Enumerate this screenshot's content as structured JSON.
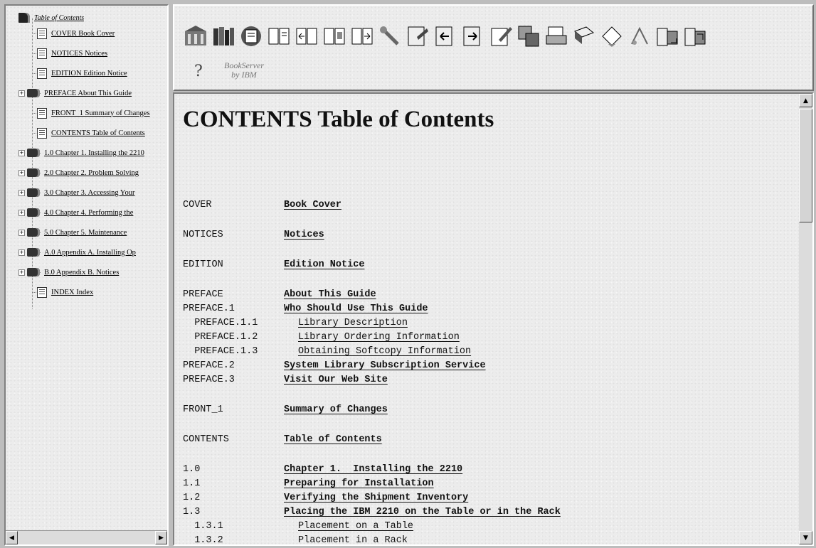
{
  "sidebar": {
    "root_label": "Table of Contents",
    "items": [
      {
        "label": "COVER Book Cover",
        "type": "page",
        "expandable": false
      },
      {
        "label": "NOTICES Notices",
        "type": "page",
        "expandable": false
      },
      {
        "label": "EDITION Edition Notice",
        "type": "page",
        "expandable": false
      },
      {
        "label": "PREFACE About This Guide",
        "type": "book",
        "expandable": true
      },
      {
        "label": "FRONT_1 Summary of Changes",
        "type": "page",
        "expandable": false
      },
      {
        "label": "CONTENTS Table of Contents",
        "type": "page",
        "expandable": false
      },
      {
        "label": "1.0 Chapter 1. Installing the 2210",
        "type": "book",
        "expandable": true
      },
      {
        "label": "2.0 Chapter 2. Problem Solving",
        "type": "book",
        "expandable": true
      },
      {
        "label": "3.0 Chapter 3. Accessing Your",
        "type": "book",
        "expandable": true
      },
      {
        "label": "4.0 Chapter 4. Performing the",
        "type": "book",
        "expandable": true
      },
      {
        "label": "5.0 Chapter 5. Maintenance",
        "type": "book",
        "expandable": true
      },
      {
        "label": "A.0 Appendix A. Installing Op",
        "type": "book",
        "expandable": true
      },
      {
        "label": "B.0 Appendix B. Notices",
        "type": "book",
        "expandable": true
      },
      {
        "label": "INDEX Index",
        "type": "page",
        "expandable": false
      }
    ],
    "expander_glyph": "+",
    "scroll_left": "◀",
    "scroll_right": "▶"
  },
  "toolbar": {
    "icons": [
      "library-icon",
      "bookshelf-icon",
      "bookmark-icon",
      "book-open-icon",
      "previous-page-icon",
      "contents-icon",
      "next-page-icon",
      "search-icon",
      "note-icon",
      "back-icon",
      "forward-icon",
      "edit-icon",
      "copy-icon",
      "print-icon",
      "book-download-icon",
      "bookmark-add-icon",
      "cut-icon",
      "paste-icon",
      "export-icon"
    ],
    "help_glyph": "?",
    "brand_line1": "BookServer",
    "brand_line2": "by IBM"
  },
  "content": {
    "title": "CONTENTS Table of Contents",
    "scroll_up": "▲",
    "scroll_down": "▼",
    "entries": [
      {
        "num": "COVER",
        "text": "Book Cover",
        "bold": true
      },
      {
        "num": "NOTICES",
        "text": "Notices",
        "bold": true
      },
      {
        "num": "EDITION",
        "text": "Edition Notice",
        "bold": true
      },
      {
        "num": "PREFACE",
        "text": "About This Guide",
        "bold": true
      },
      {
        "num": "PREFACE.1",
        "text": "Who Should Use This Guide",
        "bold": true
      },
      {
        "num": "  PREFACE.1.1",
        "text": "Library Description",
        "bold": false
      },
      {
        "num": "  PREFACE.1.2",
        "text": "Library Ordering Information",
        "bold": false
      },
      {
        "num": "  PREFACE.1.3",
        "text": "Obtaining Softcopy Information",
        "bold": false
      },
      {
        "num": "PREFACE.2",
        "text": "System Library Subscription Service",
        "bold": true
      },
      {
        "num": "PREFACE.3",
        "text": "Visit Our Web Site",
        "bold": true
      },
      {
        "num": "FRONT_1",
        "text": "Summary of Changes",
        "bold": true
      },
      {
        "num": "CONTENTS",
        "text": "Table of Contents",
        "bold": true
      },
      {
        "num": "1.0",
        "text": "Chapter 1.  Installing the 2210",
        "bold": true
      },
      {
        "num": "1.1",
        "text": "Preparing for Installation",
        "bold": true
      },
      {
        "num": "1.2",
        "text": "Verifying the Shipment Inventory",
        "bold": true
      },
      {
        "num": "1.3",
        "text": "Placing the IBM 2210 on the Table or in the Rack",
        "bold": true
      },
      {
        "num": "  1.3.1",
        "text": "Placement on a Table",
        "bold": false
      },
      {
        "num": "  1.3.2",
        "text": "Placement in a Rack",
        "bold": false
      }
    ]
  }
}
